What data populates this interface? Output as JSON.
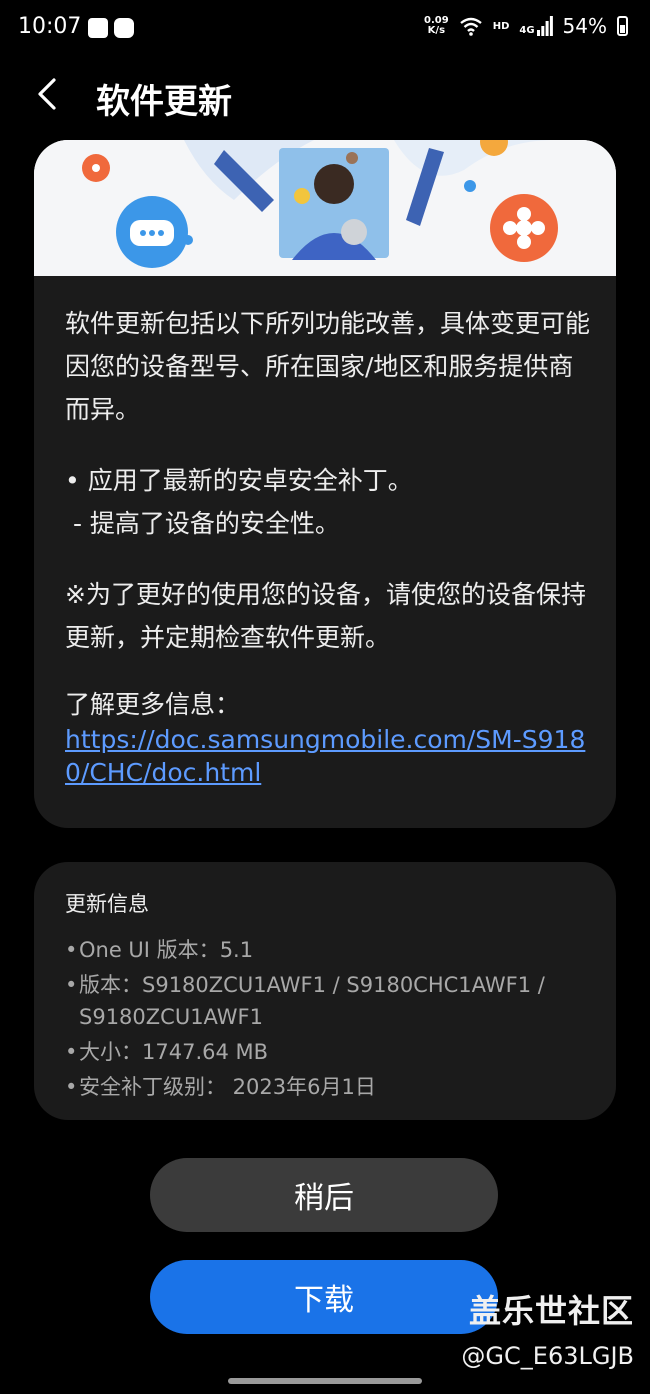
{
  "status_bar": {
    "time": "10:07",
    "net_speed_value": "0.09",
    "net_speed_unit": "K/s",
    "hd_label": "HD",
    "network_type": "4G",
    "battery": "54%"
  },
  "header": {
    "back_icon": "back-arrow-icon",
    "title": "软件更新"
  },
  "update_notes": {
    "paragraph1": "软件更新包括以下所列功能改善，具体变更可能因您的设备型号、所在国家/地区和服务提供商而异。",
    "bullet1": "• 应用了最新的安卓安全补丁。",
    "bullet1_sub": " - 提高了设备的安全性。",
    "notice": "※为了更好的使用您的设备，请使您的设备保持更新，并定期检查软件更新。",
    "more_info_label": "了解更多信息：",
    "more_info_link": "https://doc.samsungmobile.com/SM-S9180/CHC/doc.html"
  },
  "update_info": {
    "title": "更新信息",
    "rows": [
      {
        "label": "One UI 版本：",
        "value": "5.1"
      },
      {
        "label": "版本：",
        "value": "S9180ZCU1AWF1 / S9180CHC1AWF1 / S9180ZCU1AWF1"
      },
      {
        "label": "大小：",
        "value": "1747.64 MB"
      },
      {
        "label": "安全补丁级别：",
        "value": " 2023年6月1日"
      }
    ]
  },
  "buttons": {
    "later": "稍后",
    "download": "下载"
  },
  "watermark": {
    "site": "盖乐世社区",
    "handle": "@GC_E63LGJB"
  },
  "colors": {
    "background": "#000000",
    "card": "#1b1b1b",
    "link": "#5d9bff",
    "download_button": "#1a73e8",
    "later_button": "#3b3b3b"
  }
}
